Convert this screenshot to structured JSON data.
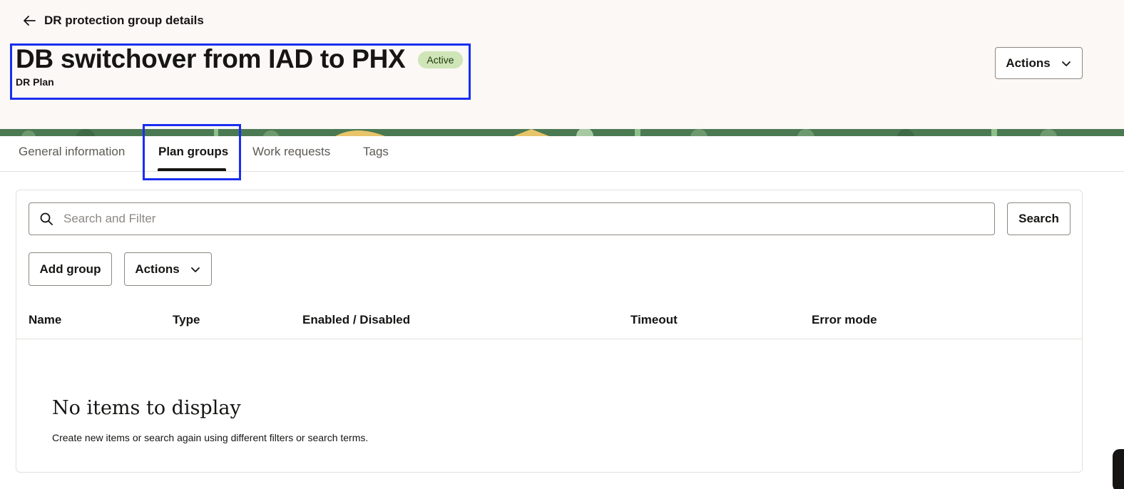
{
  "header": {
    "back_label": "DR protection group details",
    "title": "DB switchover from IAD to PHX",
    "status": "Active",
    "subtitle": "DR Plan",
    "actions_label": "Actions"
  },
  "tabs": [
    {
      "label": "General information",
      "active": false
    },
    {
      "label": "Plan groups",
      "active": true
    },
    {
      "label": "Work requests",
      "active": false
    },
    {
      "label": "Tags",
      "active": false
    }
  ],
  "toolbar": {
    "search_placeholder": "Search and Filter",
    "search_value": "",
    "search_button": "Search",
    "add_group_button": "Add group",
    "actions_label": "Actions"
  },
  "table": {
    "columns": [
      "Name",
      "Type",
      "Enabled / Disabled",
      "Timeout",
      "Error mode"
    ],
    "rows": []
  },
  "empty_state": {
    "title": "No items to display",
    "description": "Create new items or search again using different filters or search terms."
  },
  "colors": {
    "header_bg": "#fbf8f6",
    "banner_green": "#4b7a52",
    "badge_bg": "#cfe5b7",
    "highlight": "#1a2ef0"
  },
  "icons": [
    "arrow-left-icon",
    "chevron-down-icon",
    "search-icon"
  ]
}
